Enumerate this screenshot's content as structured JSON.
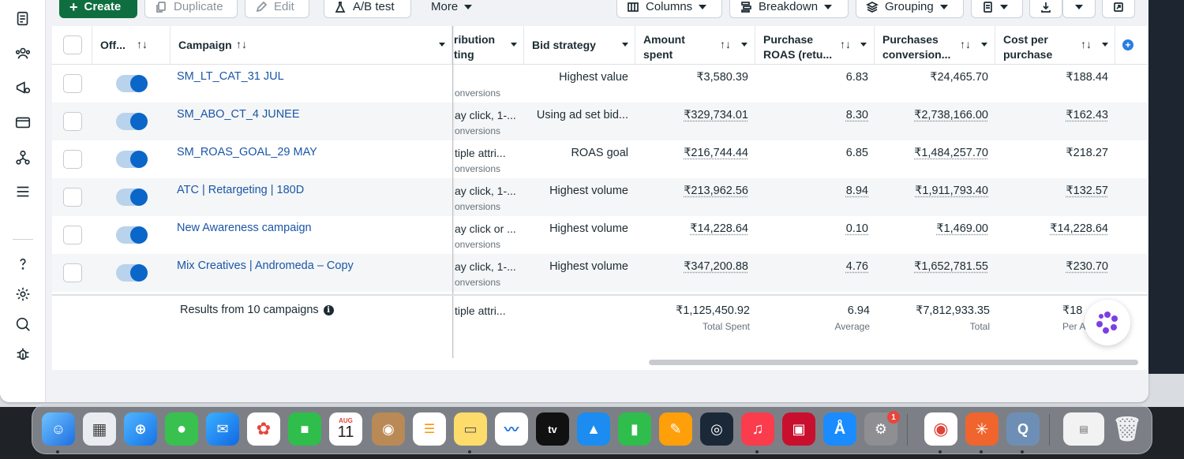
{
  "toolbar": {
    "create": "Create",
    "duplicate": "Duplicate",
    "edit": "Edit",
    "ab_test": "A/B test",
    "more": "More",
    "columns": "Columns",
    "breakdown": "Breakdown",
    "grouping": "Grouping"
  },
  "headers": {
    "off": "Off...",
    "campaign": "Campaign",
    "attribution_line1": "ribution",
    "attribution_line2": "ting",
    "bid": "Bid strategy",
    "amount_line1": "Amount",
    "amount_line2": "spent",
    "roas_line1": "Purchase",
    "roas_line2": "ROAS (retu...",
    "conv_line1": "Purchases",
    "conv_line2": "conversion...",
    "cpp_line1": "Cost per",
    "cpp_line2": "purchase",
    "sort_symbol": "↑↓"
  },
  "rows": [
    {
      "name": "SM_LT_CAT_31 JUL",
      "attr": "",
      "attr_sub": "onversions",
      "bid": "Highest value",
      "spent": "₹3,580.39",
      "roas": "6.83",
      "conv": "₹24,465.70",
      "cpp": "₹188.44"
    },
    {
      "name": "SM_ABO_CT_4 JUNEE",
      "attr": "ay click, 1-...",
      "attr_sub": "onversions",
      "bid": "Using ad set bid...",
      "spent": "₹329,734.01",
      "roas": "8.30",
      "conv": "₹2,738,166.00",
      "cpp": "₹162.43"
    },
    {
      "name": "SM_ROAS_GOAL_29 MAY",
      "attr": "tiple attri...",
      "attr_sub": "onversions",
      "bid": "ROAS goal",
      "spent": "₹216,744.44",
      "roas": "6.85",
      "conv": "₹1,484,257.70",
      "cpp": "₹218.27"
    },
    {
      "name": "ATC | Retargeting | 180D",
      "attr": "ay click, 1-...",
      "attr_sub": "onversions",
      "bid": "Highest volume",
      "spent": "₹213,962.56",
      "roas": "8.94",
      "conv": "₹1,911,793.40",
      "cpp": "₹132.57"
    },
    {
      "name": "New Awareness campaign",
      "attr": "ay click or ...",
      "attr_sub": "onversions",
      "bid": "Highest volume",
      "spent": "₹14,228.64",
      "roas": "0.10",
      "conv": "₹1,469.00",
      "cpp": "₹14,228.64"
    },
    {
      "name": "Mix Creatives | Andromeda – Copy",
      "attr": "ay click, 1-...",
      "attr_sub": "onversions",
      "bid": "Highest volume",
      "spent": "₹347,200.88",
      "roas": "4.76",
      "conv": "₹1,652,781.55",
      "cpp": "₹230.70"
    }
  ],
  "summary": {
    "results": "Results from 10 campaigns",
    "attr": "tiple attri...",
    "spent": "₹1,125,450.92",
    "spent_label": "Total Spent",
    "roas": "6.94",
    "roas_label": "Average",
    "conv": "₹7,812,933.35",
    "conv_label": "Total",
    "cpp": "₹18",
    "cpp_label": "Per A"
  },
  "dock": {
    "calendar_month": "AUG",
    "calendar_day": "11",
    "tv_label": "tv",
    "settings_badge": "1"
  },
  "colors": {
    "primary_green": "#0f6e3f",
    "link_blue": "#1a56a8",
    "toggle_blue": "#0a66c8"
  }
}
